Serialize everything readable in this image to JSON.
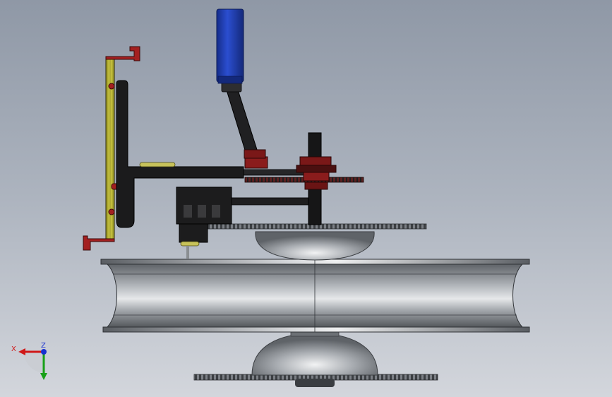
{
  "viewport": {
    "background_top": "#8f98a6",
    "background_bottom": "#d3d6dc"
  },
  "model": {
    "parts": [
      "blue-cylinder",
      "linkage-arm",
      "vertical-shaft",
      "gear-stack",
      "horizontal-bracket",
      "yellow-mount-plate",
      "red-clips",
      "motor-bracket",
      "upper-sprocket",
      "upper-hub",
      "wheel-rim",
      "lower-hub",
      "lower-sprocket"
    ],
    "colors": {
      "cylinder": "#1f3fb0",
      "frame": "#1a1a1a",
      "mount_plate": "#c8c232",
      "clips": "#9a1e1e",
      "metal": "#8e9298",
      "gear_red": "#7a1818"
    }
  },
  "triad": {
    "x_label": "X",
    "y_label": "Y",
    "z_label": "Z",
    "x_color": "#d01818",
    "y_color": "#18a018",
    "z_color": "#1830d0"
  }
}
